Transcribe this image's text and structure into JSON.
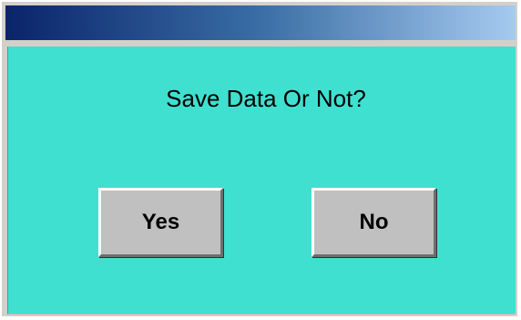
{
  "dialog": {
    "message": "Save Data Or Not?",
    "buttons": {
      "yes_label": "Yes",
      "no_label": "No"
    }
  },
  "colors": {
    "titlebar_start": "#0a246a",
    "titlebar_end": "#a6caf0",
    "body_background": "#40e0d0",
    "button_face": "#c0c0c0"
  }
}
